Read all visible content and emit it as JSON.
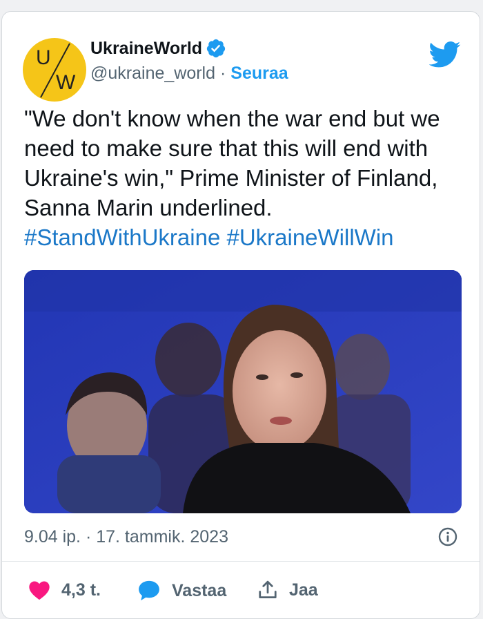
{
  "account": {
    "avatar_letters": {
      "top": "U",
      "bottom": "W"
    },
    "name": "UkraineWorld",
    "handle": "@ukraine_world",
    "separator": "·",
    "follow_label": "Seuraa",
    "verified": true
  },
  "tweet": {
    "text": "\"We don't know when the war end but we need to make sure that this will end with Ukraine's win,\" Prime Minister of Finland, Sanna Marin underlined.",
    "hashtags": "#StandWithUkraine #UkraineWillWin",
    "timestamp": "9.04 ip. · 17. tammik. 2023"
  },
  "actions": {
    "likes_count": "4,3 t.",
    "reply_label": "Vastaa",
    "share_label": "Jaa"
  },
  "colors": {
    "accent": "#1d9bf0",
    "hashtag": "#1b78c8",
    "like": "#f91880",
    "avatar_bg": "#f5c518"
  },
  "icons": [
    "verified-badge-icon",
    "twitter-bird-icon",
    "info-icon",
    "heart-icon",
    "speech-bubble-icon",
    "share-icon"
  ]
}
